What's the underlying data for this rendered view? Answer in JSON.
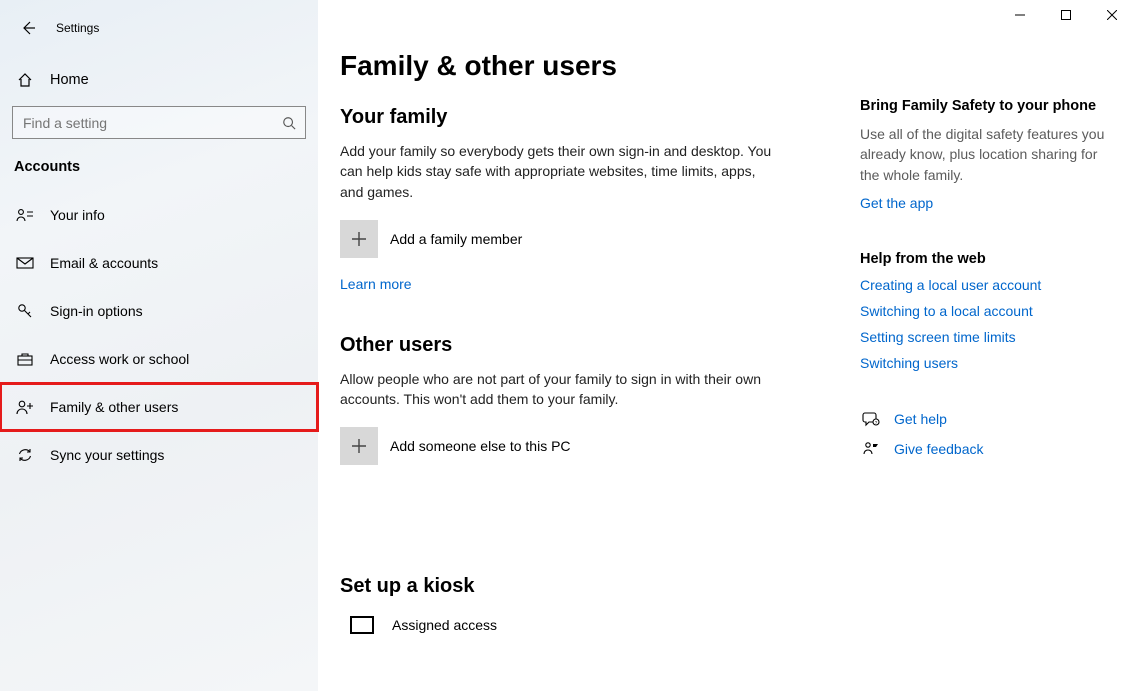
{
  "window": {
    "title": "Settings",
    "controls": {
      "min": "Minimize",
      "max": "Maximize",
      "close": "Close"
    }
  },
  "sidebar": {
    "home": "Home",
    "search_placeholder": "Find a setting",
    "section": "Accounts",
    "items": [
      {
        "icon": "person",
        "label": "Your info"
      },
      {
        "icon": "mail",
        "label": "Email & accounts"
      },
      {
        "icon": "key",
        "label": "Sign-in options"
      },
      {
        "icon": "briefcase",
        "label": "Access work or school"
      },
      {
        "icon": "person-add",
        "label": "Family & other users"
      },
      {
        "icon": "sync",
        "label": "Sync your settings"
      }
    ]
  },
  "main": {
    "title": "Family & other users",
    "family": {
      "heading": "Your family",
      "desc": "Add your family so everybody gets their own sign-in and desktop. You can help kids stay safe with appropriate websites, time limits, apps, and games.",
      "add_label": "Add a family member",
      "learn_more": "Learn more"
    },
    "others": {
      "heading": "Other users",
      "desc": "Allow people who are not part of your family to sign in with their own accounts. This won't add them to your family.",
      "add_label": "Add someone else to this PC"
    },
    "kiosk": {
      "heading": "Set up a kiosk",
      "item": "Assigned access"
    }
  },
  "aside": {
    "promo": {
      "title": "Bring Family Safety to your phone",
      "desc": "Use all of the digital safety features you already know, plus location sharing for the whole family.",
      "link": "Get the app"
    },
    "help": {
      "title": "Help from the web",
      "links": [
        "Creating a local user account",
        "Switching to a local account",
        "Setting screen time limits",
        "Switching users"
      ]
    },
    "support": {
      "get_help": "Get help",
      "feedback": "Give feedback"
    }
  }
}
